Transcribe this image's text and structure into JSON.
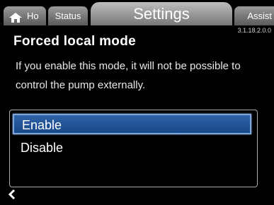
{
  "tabs": {
    "home": {
      "label": "Ho",
      "icon": "home-icon"
    },
    "status": {
      "label": "Status"
    },
    "settings": {
      "label": "Settings"
    },
    "assist": {
      "label": "Assist"
    }
  },
  "version": "3.1.18.2.0.0",
  "page": {
    "title": "Forced local mode",
    "description": "If you enable this mode, it will not be possible to control the pump externally."
  },
  "options": [
    {
      "label": "Enable",
      "selected": true
    },
    {
      "label": "Disable",
      "selected": false
    }
  ],
  "footer": {
    "back_icon": "chevron-left-icon",
    "back_label": "‹"
  },
  "colors": {
    "selection": "#2e62a7",
    "tab": "#8a8a8a",
    "background": "#000000"
  }
}
